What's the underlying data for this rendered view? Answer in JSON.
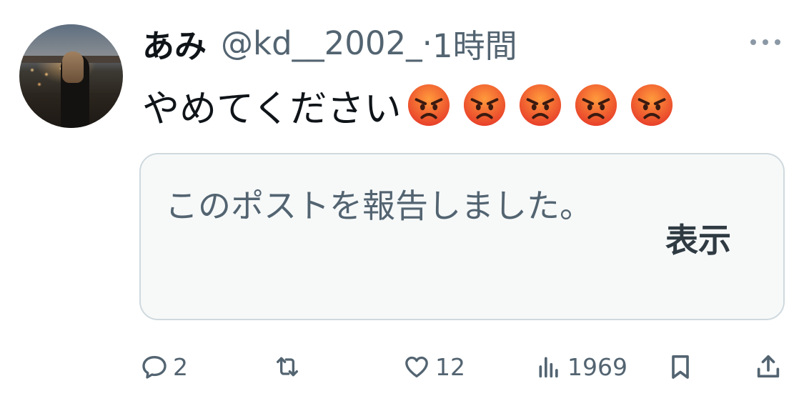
{
  "tweet": {
    "display_name": "あみ",
    "handle": "@kd__2002_",
    "separator": "·",
    "time": "1時間",
    "text": "やめてください",
    "emojis": [
      "angry-face-emoji",
      "angry-face-emoji",
      "angry-face-emoji",
      "angry-face-emoji",
      "angry-face-emoji"
    ]
  },
  "notice": {
    "message": "このポストを報告しました。",
    "show_label": "表示"
  },
  "actions": {
    "reply_count": "2",
    "retweet_count": "",
    "like_count": "12",
    "views_count": "1969"
  },
  "icons": {
    "more": "more-options-icon",
    "reply": "reply-icon",
    "retweet": "retweet-icon",
    "like": "heart-icon",
    "views": "views-chart-icon",
    "bookmark": "bookmark-icon",
    "share": "share-icon"
  },
  "colors": {
    "text_primary": "#0f1419",
    "text_secondary": "#536471",
    "card_background": "#f7f9f9",
    "card_border": "#cfd9de"
  }
}
